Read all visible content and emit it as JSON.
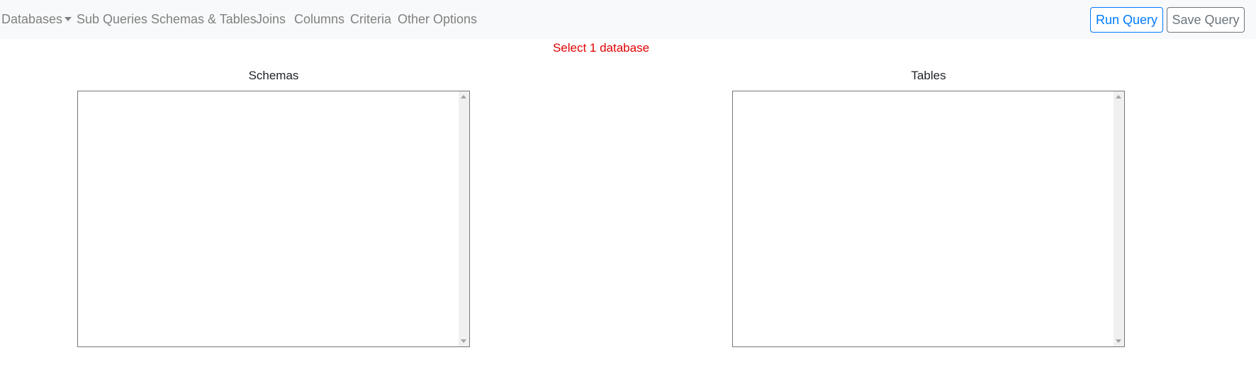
{
  "nav": {
    "items": [
      {
        "label": "Databases",
        "has_caret": true
      },
      {
        "label": "Sub Queries"
      },
      {
        "label": "Schemas & Tables"
      },
      {
        "label": "Joins"
      },
      {
        "label": "Columns"
      },
      {
        "label": "Criteria"
      },
      {
        "label": "Other Options"
      }
    ],
    "run_label": "Run Query",
    "save_label": "Save Query"
  },
  "message": "Select 1 database",
  "panels": {
    "schemas_label": "Schemas",
    "tables_label": "Tables"
  },
  "colors": {
    "nav_background": "#f8f9fa",
    "nav_text": "#808080",
    "primary": "#007bff",
    "secondary": "#6c757d",
    "message": "#e00000"
  },
  "icons": {
    "dropdown": "caret-down-icon",
    "scroll_up": "scroll-up-arrow-icon",
    "scroll_down": "scroll-down-arrow-icon"
  }
}
